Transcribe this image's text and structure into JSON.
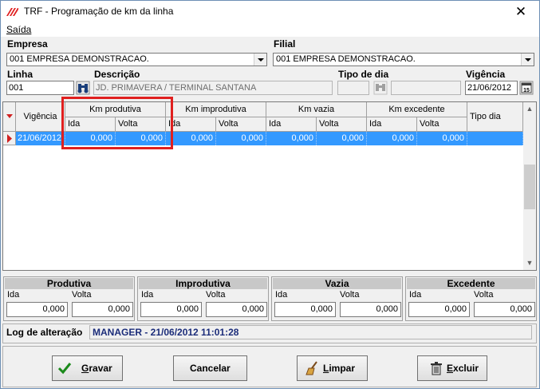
{
  "window": {
    "title": "TRF - Programação de km da linha",
    "close_glyph": "✕"
  },
  "menu": {
    "items": [
      {
        "label": "Saída"
      }
    ]
  },
  "form": {
    "empresa_label": "Empresa",
    "empresa_value": "001 EMPRESA DEMONSTRACAO.",
    "filial_label": "Filial",
    "filial_value": "001 EMPRESA DEMONSTRACAO.",
    "linha_label": "Linha",
    "linha_value": "001",
    "descricao_label": "Descrição",
    "descricao_value": "JD. PRIMAVERA / TERMINAL SANTANA",
    "tipo_dia_label": "Tipo de dia",
    "tipo_dia_value": "",
    "vigencia_label": "Vigência",
    "vigencia_value": "21/06/2012"
  },
  "grid": {
    "vigencia_header": "Vigência",
    "groups": [
      "Km produtiva",
      "Km improdutiva",
      "Km vazia",
      "Km excedente"
    ],
    "sub_ida": "Ida",
    "sub_volta": "Volta",
    "tipo_dia_header": "Tipo dia",
    "rows": [
      {
        "vigencia": "21/06/2012",
        "values": [
          "0,000",
          "0,000",
          "0,000",
          "0,000",
          "0,000",
          "0,000",
          "0,000",
          "0,000"
        ],
        "tipo_dia": ""
      }
    ]
  },
  "summary": {
    "ida_label": "Ida",
    "volta_label": "Volta",
    "panels": [
      {
        "title": "Produtiva",
        "ida": "0,000",
        "volta": "0,000"
      },
      {
        "title": "Improdutiva",
        "ida": "0,000",
        "volta": "0,000"
      },
      {
        "title": "Vazia",
        "ida": "0,000",
        "volta": "0,000"
      },
      {
        "title": "Excedente",
        "ida": "0,000",
        "volta": "0,000"
      }
    ]
  },
  "log": {
    "label": "Log de alteração",
    "value": "MANAGER - 21/06/2012 11:01:28"
  },
  "buttons": {
    "gravar": {
      "pre": "",
      "mnemonic": "G",
      "post": "ravar",
      "icon": "checkmark-icon"
    },
    "cancelar": {
      "label": "Cancelar"
    },
    "limpar": {
      "pre": "",
      "mnemonic": "L",
      "post": "impar",
      "icon": "broom-icon"
    },
    "excluir": {
      "pre": "",
      "mnemonic": "E",
      "post": "xcluir",
      "icon": "trash-icon"
    }
  },
  "colors": {
    "selection": "#3399ff",
    "highlight_box": "#e0201f",
    "log_text": "#1c2d7a"
  }
}
